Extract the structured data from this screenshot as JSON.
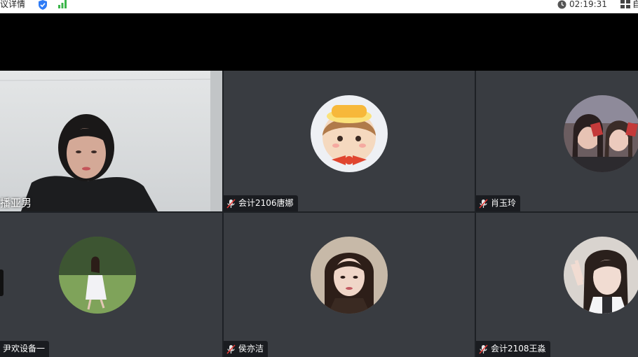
{
  "topbar": {
    "title_fragment": "议详情",
    "time": "02:19:31",
    "trailing_fragment": "自"
  },
  "participants": [
    {
      "name": "播亚男",
      "video": true,
      "muted": false
    },
    {
      "name": "会计2106唐娜",
      "video": false,
      "muted": true
    },
    {
      "name": "肖玉玲",
      "video": false,
      "muted": true
    },
    {
      "name": "尹欢设备一",
      "video": false,
      "muted": false
    },
    {
      "name": "侯亦洁",
      "video": false,
      "muted": true
    },
    {
      "name": "会计2108王淼",
      "video": false,
      "muted": true
    }
  ],
  "colors": {
    "tile_bg": "#393c41",
    "gap": "#1e2125",
    "namebar_bg": "#181a1d",
    "mic_muted": "#e8e8e8",
    "shield": "#2f7cf6",
    "signal": "#3bb54a"
  }
}
